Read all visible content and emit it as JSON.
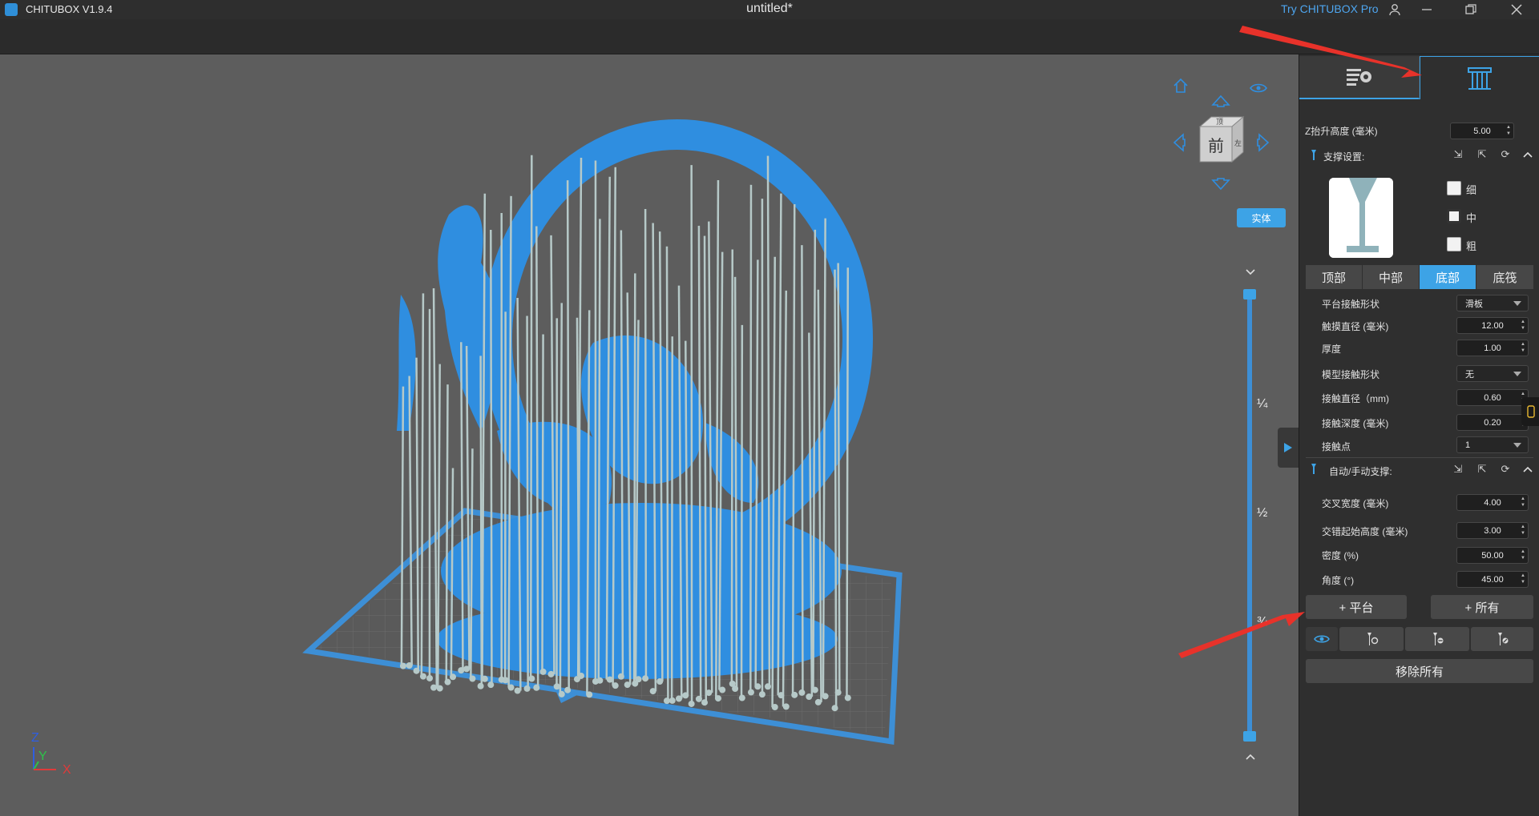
{
  "window": {
    "app_name": "CHITUBOX V1.9.4",
    "doc_title": "untitled*",
    "try_pro": "Try CHITUBOX Pro"
  },
  "view": {
    "cube_face": "前",
    "cube_top": "顶",
    "cube_side": "左",
    "render_mode": "实体",
    "slider_marks": [
      "¼",
      "½",
      "¾"
    ],
    "axis": {
      "z": "Z",
      "y": "Y",
      "x": "X"
    }
  },
  "panel": {
    "z_lift_label": "Z抬升高度 (毫米)",
    "z_lift_value": "5.00",
    "support_settings_label": "支撑设置:",
    "support_density": {
      "thin": "细",
      "medium": "中",
      "thick": "粗"
    },
    "section_tabs": [
      "顶部",
      "中部",
      "底部",
      "底筏"
    ],
    "active_tab_index": 2,
    "fields1": [
      {
        "label": "平台接触形状",
        "value": "滑板",
        "type": "select"
      },
      {
        "label": "触摸直径 (毫米)",
        "value": "12.00",
        "type": "spin"
      },
      {
        "label": "厚度",
        "value": "1.00",
        "type": "spin"
      },
      {
        "label": "模型接触形状",
        "value": "无",
        "type": "select"
      },
      {
        "label": "接触直径（mm)",
        "value": "0.60",
        "type": "spin"
      },
      {
        "label": "接触深度 (毫米)",
        "value": "0.20",
        "type": "spin"
      },
      {
        "label": "接触点",
        "value": "1",
        "type": "select"
      }
    ],
    "auto_support_label": "自动/手动支撑:",
    "fields2": [
      {
        "label": "交叉宽度 (毫米)",
        "value": "4.00"
      },
      {
        "label": "交错起始高度 (毫米)",
        "value": "3.00"
      },
      {
        "label": "密度 (%)",
        "value": "50.00"
      },
      {
        "label": "角度 (°)",
        "value": "45.00"
      }
    ],
    "add_platform": "+ 平台",
    "add_all": "+ 所有",
    "remove_all": "移除所有"
  },
  "colors": {
    "accent": "#3da3e6",
    "model": "#2f8ee0",
    "support": "#b6c9c8",
    "annotation": "#e8322a"
  }
}
